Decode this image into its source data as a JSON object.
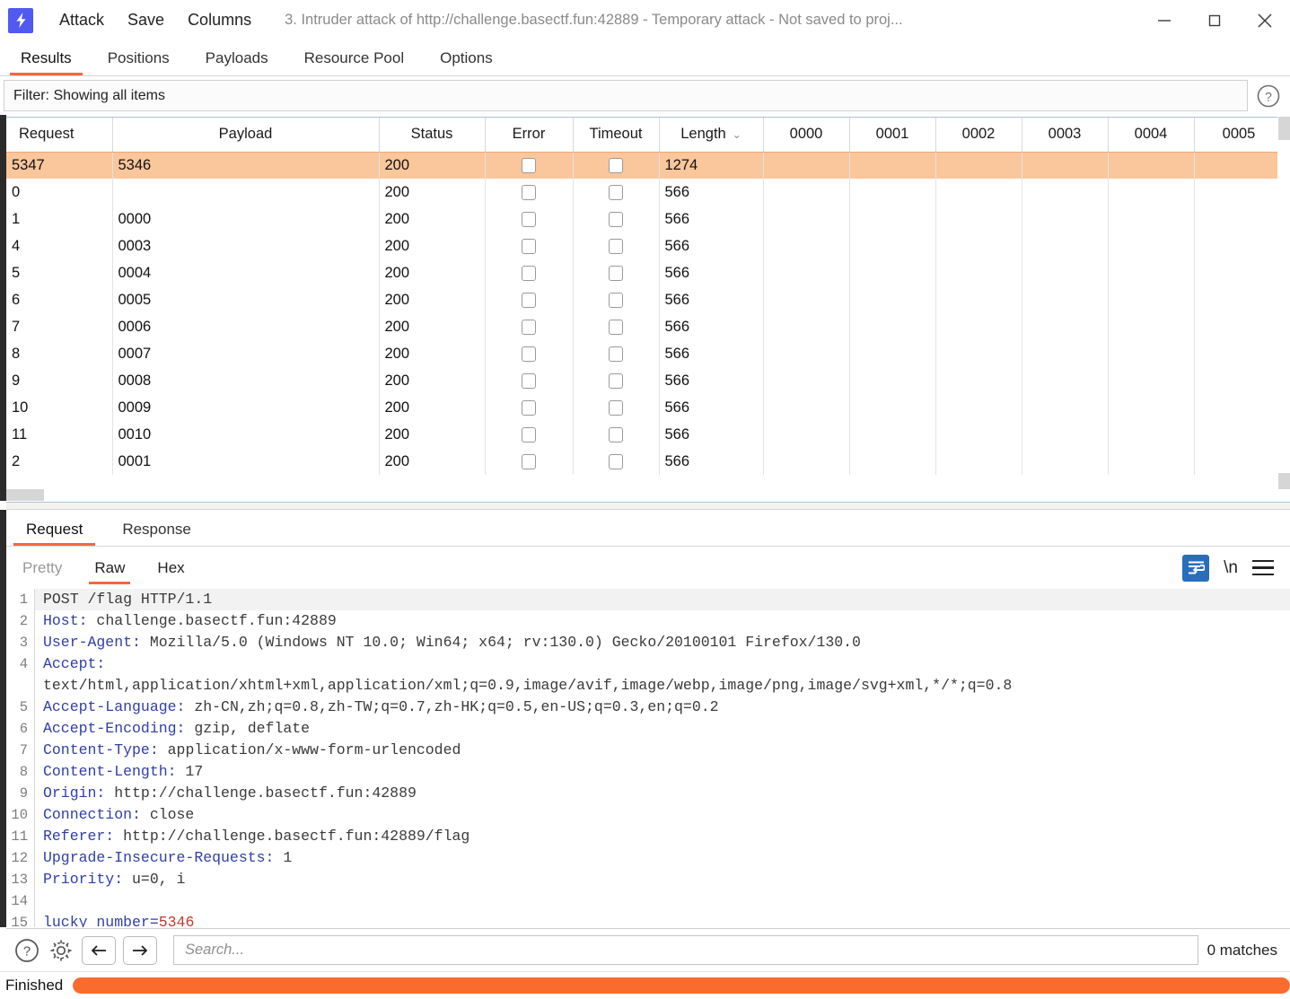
{
  "titlebar": {
    "logo_icon": "burp-lightning-icon",
    "menu": [
      {
        "label": "Attack"
      },
      {
        "label": "Save"
      },
      {
        "label": "Columns"
      }
    ],
    "window_title": "3. Intruder attack of http://challenge.basectf.fun:42889 - Temporary attack - Not saved to proj...",
    "minimize_icon": "minimize-icon",
    "maximize_icon": "maximize-icon",
    "close_icon": "close-icon"
  },
  "tabs": [
    {
      "label": "Results",
      "active": true
    },
    {
      "label": "Positions",
      "active": false
    },
    {
      "label": "Payloads",
      "active": false
    },
    {
      "label": "Resource Pool",
      "active": false
    },
    {
      "label": "Options",
      "active": false
    }
  ],
  "filter": {
    "text": "Filter: Showing all items",
    "help_icon": "question-circle-icon"
  },
  "results_table": {
    "columns": [
      "Request",
      "Payload",
      "Status",
      "Error",
      "Timeout",
      "Length",
      "0000",
      "0001",
      "0002",
      "0003",
      "0004",
      "0005"
    ],
    "sorted_column": "Length",
    "sort_caret": "⌄",
    "rows": [
      {
        "request": "5347",
        "payload": "5346",
        "status": "200",
        "error": false,
        "timeout": false,
        "length": "1274",
        "selected": true
      },
      {
        "request": "0",
        "payload": "",
        "status": "200",
        "error": false,
        "timeout": false,
        "length": "566",
        "selected": false
      },
      {
        "request": "1",
        "payload": "0000",
        "status": "200",
        "error": false,
        "timeout": false,
        "length": "566",
        "selected": false
      },
      {
        "request": "4",
        "payload": "0003",
        "status": "200",
        "error": false,
        "timeout": false,
        "length": "566",
        "selected": false
      },
      {
        "request": "5",
        "payload": "0004",
        "status": "200",
        "error": false,
        "timeout": false,
        "length": "566",
        "selected": false
      },
      {
        "request": "6",
        "payload": "0005",
        "status": "200",
        "error": false,
        "timeout": false,
        "length": "566",
        "selected": false
      },
      {
        "request": "7",
        "payload": "0006",
        "status": "200",
        "error": false,
        "timeout": false,
        "length": "566",
        "selected": false
      },
      {
        "request": "8",
        "payload": "0007",
        "status": "200",
        "error": false,
        "timeout": false,
        "length": "566",
        "selected": false
      },
      {
        "request": "9",
        "payload": "0008",
        "status": "200",
        "error": false,
        "timeout": false,
        "length": "566",
        "selected": false
      },
      {
        "request": "10",
        "payload": "0009",
        "status": "200",
        "error": false,
        "timeout": false,
        "length": "566",
        "selected": false
      },
      {
        "request": "11",
        "payload": "0010",
        "status": "200",
        "error": false,
        "timeout": false,
        "length": "566",
        "selected": false
      },
      {
        "request": "2",
        "payload": "0001",
        "status": "200",
        "error": false,
        "timeout": false,
        "length": "566",
        "selected": false
      }
    ]
  },
  "message_tabs": [
    {
      "label": "Request",
      "active": true
    },
    {
      "label": "Response",
      "active": false
    }
  ],
  "view_tabs": [
    {
      "label": "Pretty",
      "active": false,
      "disabled": true
    },
    {
      "label": "Raw",
      "active": true,
      "disabled": false
    },
    {
      "label": "Hex",
      "active": false,
      "disabled": false
    }
  ],
  "editor_tools": {
    "wrap_icon": "word-wrap-icon",
    "newline_label": "\\n",
    "menu_icon": "hamburger-menu-icon"
  },
  "request": {
    "lines": [
      {
        "num": "1",
        "key": "",
        "value": "POST /flag HTTP/1.1",
        "plain": true
      },
      {
        "num": "2",
        "key": "Host:",
        "value": " challenge.basectf.fun:42889"
      },
      {
        "num": "3",
        "key": "User-Agent:",
        "value": " Mozilla/5.0 (Windows NT 10.0; Win64; x64; rv:130.0) Gecko/20100101 Firefox/130.0"
      },
      {
        "num": "4",
        "key": "Accept:",
        "value": ""
      },
      {
        "num": "",
        "key": "",
        "value": "text/html,application/xhtml+xml,application/xml;q=0.9,image/avif,image/webp,image/png,image/svg+xml,*/*;q=0.8",
        "wrapcont": true
      },
      {
        "num": "5",
        "key": "Accept-Language:",
        "value": " zh-CN,zh;q=0.8,zh-TW;q=0.7,zh-HK;q=0.5,en-US;q=0.3,en;q=0.2"
      },
      {
        "num": "6",
        "key": "Accept-Encoding:",
        "value": " gzip, deflate"
      },
      {
        "num": "7",
        "key": "Content-Type:",
        "value": " application/x-www-form-urlencoded"
      },
      {
        "num": "8",
        "key": "Content-Length:",
        "value": " 17"
      },
      {
        "num": "9",
        "key": "Origin:",
        "value": " http://challenge.basectf.fun:42889"
      },
      {
        "num": "10",
        "key": "Connection:",
        "value": " close"
      },
      {
        "num": "11",
        "key": "Referer:",
        "value": " http://challenge.basectf.fun:42889/flag"
      },
      {
        "num": "12",
        "key": "Upgrade-Insecure-Requests:",
        "value": " 1"
      },
      {
        "num": "13",
        "key": "Priority:",
        "value": " u=0, i"
      },
      {
        "num": "14",
        "key": "",
        "value": ""
      },
      {
        "num": "15",
        "key": "lucky_number",
        "value": "5346",
        "body": true
      }
    ]
  },
  "findbar": {
    "help_icon": "question-circle-icon",
    "settings_icon": "gear-icon",
    "prev_icon": "arrow-left-icon",
    "next_icon": "arrow-right-icon",
    "search_value": "",
    "search_placeholder": "Search...",
    "matches": "0 matches"
  },
  "statusbar": {
    "text": "Finished",
    "progress_percent": 100
  },
  "colors": {
    "accent": "#f2683c",
    "selection": "#fac69b",
    "logo": "#5159f0",
    "header_key": "#2f3fa8",
    "body_value": "#c0392b",
    "progress": "#f96c2e"
  }
}
